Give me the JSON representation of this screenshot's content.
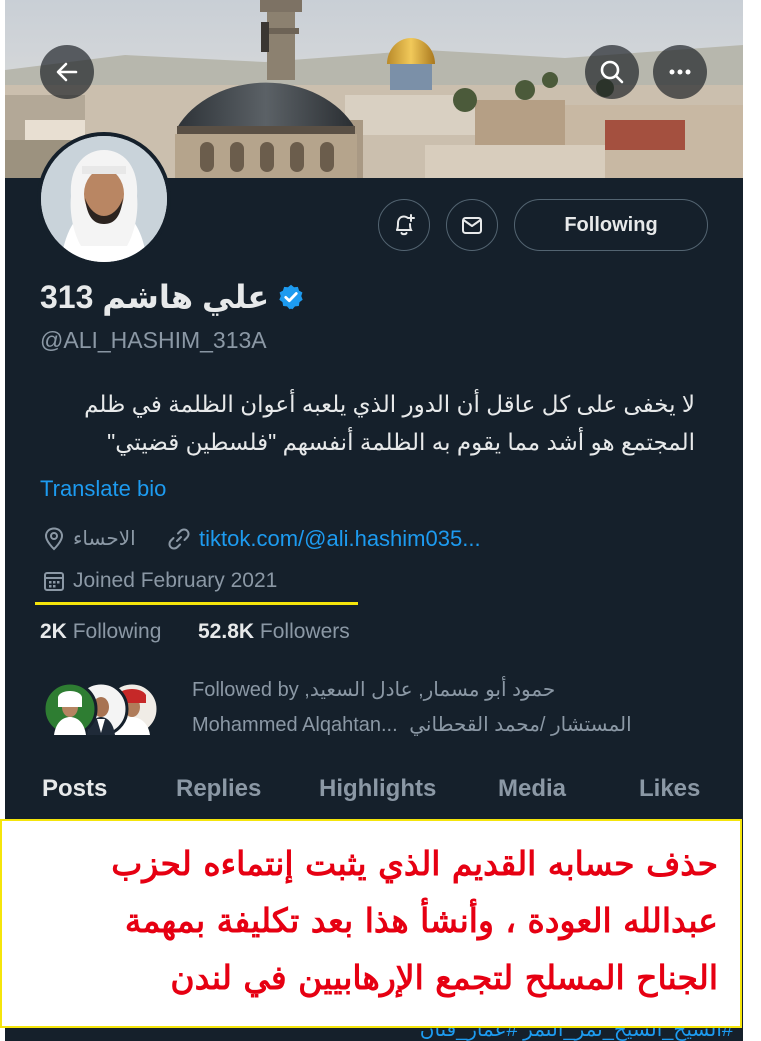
{
  "header": {
    "back_icon": "arrow-left-icon",
    "search_icon": "search-icon",
    "more_icon": "more-horizontal-icon"
  },
  "profile": {
    "display_name": "علي هاشم 313",
    "handle": "@ALI_HASHIM_313A",
    "verified": true,
    "bio_line1": "لا يخفى على كل عاقل أن الدور الذي يلعبه أعوان الظلمة في ظلم",
    "bio_line2": "المجتمع هو أشد مما يقوم به الظلمة أنفسهم \"فلسطين قضيتي\"",
    "translate_label": "Translate bio",
    "location": "الاحساء",
    "website": "tiktok.com/@ali.hashim035...",
    "joined": "Joined February 2021",
    "following_count": "2K",
    "following_label": "Following",
    "followers_count": "52.8K",
    "followers_label": "Followers",
    "followed_by_line1_prefix": "Followed by",
    "followed_by_line1_names": "حمود أبو مسمار, عادل السعيد,",
    "followed_by_line2_names": "Mohammed Alqahtan...",
    "followed_by_line2_arabic": "المستشار /محمد القحطاني"
  },
  "actions": {
    "notify_icon": "bell-plus-icon",
    "message_icon": "mail-icon",
    "following_button": "Following"
  },
  "tabs": [
    "Posts",
    "Replies",
    "Highlights",
    "Media",
    "Likes"
  ],
  "overlay": {
    "line1": "حذف حسابه القديم الذي يثبت إنتماءه لحزب",
    "line2": "عبدالله العودة ، وأنشأ هذا بعد تكليفة بمهمة",
    "line3": "الجناح المسلح لتجمع الإرهابيين في لندن"
  },
  "bottom_strip": "#الشيخ_الشيخ_نمر_النمر #عمار_قتان",
  "colors": {
    "background": "#15202b",
    "accent": "#1d9bf0",
    "text": "#e7e9ea",
    "muted": "#8b98a5",
    "overlay_text": "#e60012",
    "underline": "#f5e50b"
  }
}
